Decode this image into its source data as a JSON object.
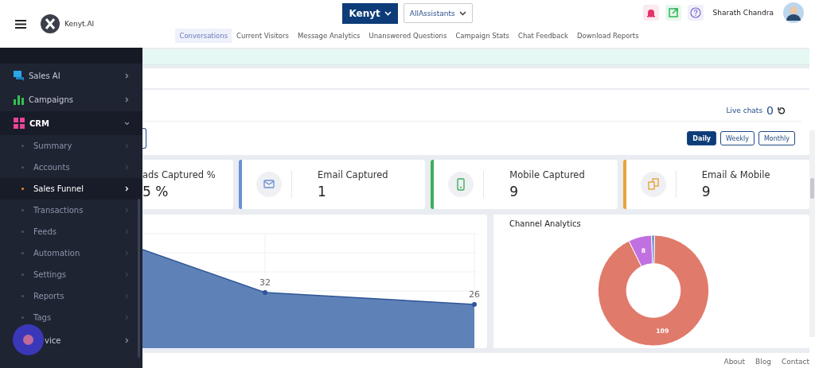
{
  "header": {
    "brand": "Kenyt.AI",
    "workspace": "Kenyt",
    "assistant": "AllAssistants",
    "user": "Sharath Chandra"
  },
  "tabs": [
    {
      "label": "Conversations",
      "selected": true
    },
    {
      "label": "Current Visitors",
      "selected": false
    },
    {
      "label": "Message Analytics",
      "selected": false
    },
    {
      "label": "Unanswered Questions",
      "selected": false
    },
    {
      "label": "Campaign Stats",
      "selected": false
    },
    {
      "label": "Chat Feedback",
      "selected": false
    },
    {
      "label": "Download Reports",
      "selected": false
    }
  ],
  "sidebar": {
    "items": [
      {
        "label": "Sales AI",
        "kind": "chat",
        "expanded": false
      },
      {
        "label": "Campaigns",
        "kind": "bars",
        "expanded": false
      },
      {
        "label": "CRM",
        "kind": "grid",
        "expanded": true,
        "children": [
          {
            "label": "Summary",
            "selected": false
          },
          {
            "label": "Accounts",
            "selected": false
          },
          {
            "label": "Sales Funnel",
            "selected": true
          },
          {
            "label": "Transactions",
            "selected": false
          },
          {
            "label": "Feeds",
            "selected": false
          },
          {
            "label": "Automation",
            "selected": false
          },
          {
            "label": "Settings",
            "selected": false
          },
          {
            "label": "Reports",
            "selected": false
          },
          {
            "label": "Tags",
            "selected": false
          }
        ]
      },
      {
        "label": "vice",
        "kind": "plain",
        "expanded": false
      }
    ]
  },
  "live_chats": {
    "label": "Live chats",
    "count": "0"
  },
  "periods": [
    {
      "label": "Daily",
      "selected": true
    },
    {
      "label": "Weekly",
      "selected": false
    },
    {
      "label": "Monthly",
      "selected": false
    }
  ],
  "stats": [
    {
      "label": "ads Captured %",
      "value": "5 %",
      "kind": "partial"
    },
    {
      "label": "Email Captured",
      "value": "1",
      "kind": "email",
      "color": "#6b8fd6"
    },
    {
      "label": "Mobile Captured",
      "value": "9",
      "kind": "mobile",
      "color": "#3fae5a"
    },
    {
      "label": "Email & Mobile",
      "value": "9",
      "kind": "both",
      "color": "#e8a33a"
    }
  ],
  "trend": {
    "point_labels": [
      "32",
      "26"
    ]
  },
  "channels": {
    "title": "Channel Analytics",
    "chart_data": {
      "type": "donut",
      "values": [
        109,
        8,
        1
      ],
      "value_labels": [
        "109",
        "8",
        null
      ],
      "colors": [
        "#e07a6a",
        "#c070e0",
        "#6a8fd0"
      ]
    }
  },
  "footer": [
    "About",
    "Blog",
    "Contact"
  ]
}
